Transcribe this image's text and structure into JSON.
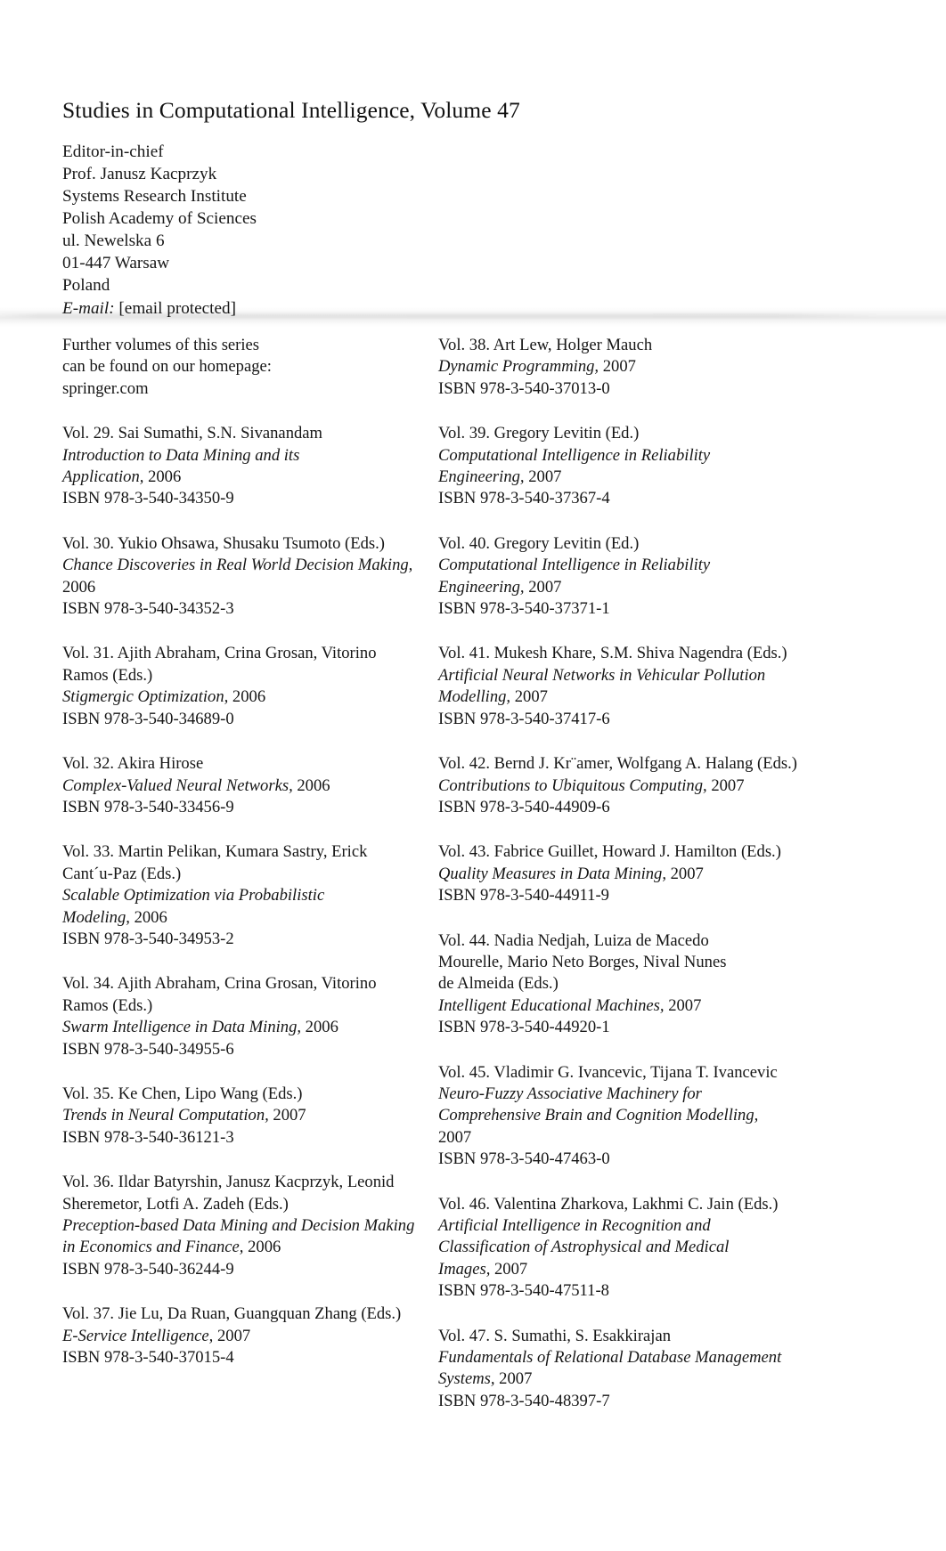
{
  "header": {
    "series_title": "Studies in Computational Intelligence, Volume 47",
    "editor_role": "Editor-in-chief",
    "editor_name": "Prof. Janusz Kacprzyk",
    "institute": "Systems Research Institute",
    "academy": "Polish Academy of Sciences",
    "street": "ul. Newelska 6",
    "postal_city": "01-447 Warsaw",
    "country": "Poland",
    "email_label": "E-mail:",
    "email_value": "[email protected]"
  },
  "intro": {
    "line1": "Further volumes of this series",
    "line2": "can be found on our homepage:",
    "line3": "springer.com"
  },
  "left_entries": [
    {
      "authors": "Vol. 29. Sai Sumathi, S.N. Sivanandam",
      "title_lines": [
        "Introduction to Data Mining and its",
        "Application,"
      ],
      "year": "2006",
      "isbn": "ISBN 978-3-540-34350-9"
    },
    {
      "authors": "Vol. 30. Yukio Ohsawa, Shusaku Tsumoto (Eds.)",
      "title_lines": [
        "Chance Discoveries in Real World Decision Making,"
      ],
      "year": "2006",
      "year_on_own_line": true,
      "isbn": "ISBN 978-3-540-34352-3"
    },
    {
      "authors": "Vol. 31. Ajith Abraham, Crina Grosan, Vitorino",
      "authors_cont": "Ramos (Eds.)",
      "title_lines": [
        "Stigmergic Optimization,"
      ],
      "year": "2006",
      "isbn": "ISBN 978-3-540-34689-0"
    },
    {
      "authors": "Vol. 32. Akira Hirose",
      "title_lines": [
        "Complex-Valued Neural Networks,"
      ],
      "year": "2006",
      "isbn": "ISBN 978-3-540-33456-9"
    },
    {
      "authors": "Vol. 33. Martin Pelikan, Kumara Sastry, Erick",
      "authors_cont": "Cant´u-Paz (Eds.)",
      "title_lines": [
        "Scalable Optimization via Probabilistic",
        "Modeling,"
      ],
      "year": "2006",
      "isbn": "ISBN 978-3-540-34953-2"
    },
    {
      "authors": "Vol. 34. Ajith Abraham, Crina Grosan, Vitorino",
      "authors_cont": "Ramos (Eds.)",
      "title_lines": [
        "Swarm Intelligence in Data Mining,"
      ],
      "year": "2006",
      "isbn": "ISBN 978-3-540-34955-6"
    },
    {
      "authors": "Vol. 35. Ke Chen, Lipo Wang (Eds.)",
      "title_lines": [
        "Trends in Neural Computation,"
      ],
      "year": "2007",
      "isbn": "ISBN 978-3-540-36121-3"
    },
    {
      "authors": "Vol. 36. Ildar Batyrshin, Janusz Kacprzyk, Leonid",
      "authors_cont": "Sheremetor, Lotfi A. Zadeh (Eds.)",
      "title_lines": [
        "Preception-based Data Mining and Decision Making",
        "in Economics and Finance,"
      ],
      "year": "2006",
      "isbn": "ISBN 978-3-540-36244-9"
    },
    {
      "authors": "Vol. 37. Jie Lu, Da Ruan, Guangquan Zhang (Eds.)",
      "title_lines": [
        "E-Service Intelligence,"
      ],
      "year": "2007",
      "isbn": "ISBN 978-3-540-37015-4"
    }
  ],
  "right_entries": [
    {
      "authors": "Vol. 38. Art Lew, Holger Mauch",
      "title_lines": [
        "Dynamic Programming,"
      ],
      "year": "2007",
      "isbn": "ISBN 978-3-540-37013-0"
    },
    {
      "authors": "Vol. 39. Gregory Levitin (Ed.)",
      "title_lines": [
        "Computational Intelligence in Reliability",
        "Engineering,"
      ],
      "year": "2007",
      "isbn": "ISBN 978-3-540-37367-4"
    },
    {
      "authors": "Vol. 40. Gregory Levitin (Ed.)",
      "title_lines": [
        "Computational Intelligence in Reliability",
        "Engineering,"
      ],
      "year": "2007",
      "isbn": "ISBN 978-3-540-37371-1"
    },
    {
      "authors": "Vol. 41. Mukesh Khare, S.M. Shiva Nagendra (Eds.)",
      "title_lines": [
        "Artificial Neural Networks in Vehicular Pollution",
        "Modelling,"
      ],
      "year": "2007",
      "isbn": "ISBN 978-3-540-37417-6"
    },
    {
      "authors": "Vol. 42. Bernd J. Kr¨amer, Wolfgang A. Halang (Eds.)",
      "title_lines": [
        "Contributions to Ubiquitous Computing,"
      ],
      "year": "2007",
      "isbn": "ISBN 978-3-540-44909-6"
    },
    {
      "authors": "Vol. 43. Fabrice Guillet, Howard J. Hamilton (Eds.)",
      "title_lines": [
        "Quality Measures in Data Mining,"
      ],
      "year": "2007",
      "isbn": "ISBN 978-3-540-44911-9"
    },
    {
      "authors": "Vol. 44. Nadia Nedjah, Luiza de Macedo",
      "authors_cont": "Mourelle, Mario Neto Borges, Nival Nunes",
      "authors_cont2": "de Almeida (Eds.)",
      "title_lines": [
        "Intelligent Educational Machines,"
      ],
      "year": "2007",
      "isbn": "ISBN 978-3-540-44920-1"
    },
    {
      "authors": "Vol. 45. Vladimir G. Ivancevic, Tijana T. Ivancevic",
      "title_lines": [
        "Neuro-Fuzzy Associative Machinery for",
        "Comprehensive Brain and Cognition Modelling,"
      ],
      "year": "2007",
      "year_on_own_line": true,
      "isbn": "ISBN 978-3-540-47463-0"
    },
    {
      "authors": "Vol. 46. Valentina Zharkova, Lakhmi C. Jain (Eds.)",
      "title_lines": [
        "Artificial Intelligence in Recognition and",
        "Classification of Astrophysical and Medical",
        "Images,"
      ],
      "year": "2007",
      "isbn": "ISBN 978-3-540-47511-8"
    },
    {
      "authors": "Vol. 47. S. Sumathi, S. Esakkirajan",
      "title_lines": [
        "Fundamentals of Relational Database Management",
        "Systems,"
      ],
      "year": "2007",
      "isbn": "ISBN 978-3-540-48397-7"
    }
  ]
}
